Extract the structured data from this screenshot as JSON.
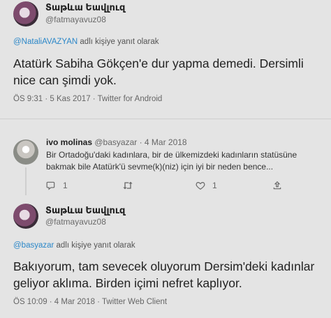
{
  "tweet1": {
    "name": "Տաթևա Եավլուզ",
    "handle": "@fatmayavuz08",
    "reply_prefix": "@NataliAVAZYAN",
    "reply_suffix": " adlı kişiye yanıt olarak",
    "text_line1": "Atatürk Sabiha Gökçen'e dur yapma demedi. Dersimli",
    "text_line2": "nice can şimdi yok.",
    "meta": "ÖS 9:31 · 5 Kas 2017 · Twitter for Android"
  },
  "quoted": {
    "name": "ivo molinas",
    "handle_date": " @basyazar · 4 Mar 2018",
    "text_line1": "Bir Ortadoğu'daki kadınlara, bir de ülkemizdeki kadınların statüsüne",
    "text_line2": "bakmak bile Atatürk'ü sevme(k)(niz) için iyi bir neden bence...",
    "reply_count": "1",
    "retweet_count": "",
    "like_count": "1"
  },
  "tweet2": {
    "name": "Տաթևա Եավլուզ",
    "handle": "@fatmayavuz08",
    "reply_prefix": "@basyazar",
    "reply_suffix": " adlı kişiye yanıt olarak",
    "text_line1": "Bakıyorum, tam sevecek oluyorum Dersim'deki kadınlar",
    "text_line2": "geliyor aklıma. Birden içimi nefret kaplıyor.",
    "meta": "ÖS 10:09 · 4 Mar 2018 · Twitter Web Client"
  },
  "colors": {
    "background": "#e4e4e4",
    "mention": "#2b87c8"
  },
  "icons": [
    "reply-icon",
    "retweet-icon",
    "like-icon",
    "share-icon"
  ]
}
